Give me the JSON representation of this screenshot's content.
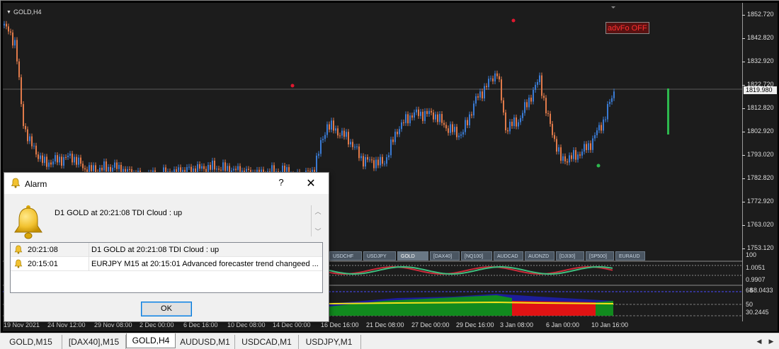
{
  "chart": {
    "symbol_label": "GOLD,H4",
    "advfo_label": "advFo OFF",
    "current_price": "1819.980",
    "price_ticks": [
      "1852.720",
      "1842.820",
      "1832.920",
      "1822.720",
      "1812.820",
      "1802.920",
      "1793.020",
      "1782.820",
      "1772.920",
      "1763.020",
      "1753.120"
    ],
    "colors": {
      "bull": "#3a7bd5",
      "bear": "#e07a4a",
      "signal_green": "#2db84d",
      "signal_red": "#e0182f",
      "background": "#1c1c1c"
    }
  },
  "symbol_bar": [
    "USDCHF",
    "USDJPY",
    "GOLD",
    "[DAX40]",
    "[NQ100]",
    "AUDCAD",
    "AUDNZD",
    "[DJI30]",
    "[SP500]",
    "EURAUD"
  ],
  "symbol_bar_active": "GOLD",
  "indicator1": {
    "ticks": [
      "100",
      "1.0051",
      "0.9907"
    ]
  },
  "indicator2": {
    "ticks": [
      "68",
      "68.0433",
      "50",
      "30.2445"
    ]
  },
  "date_axis": [
    "19 Nov 2021",
    "24 Nov 12:00",
    "29 Nov 08:00",
    "2 Dec 00:00",
    "6 Dec 16:00",
    "10 Dec 08:00",
    "14 Dec 00:00",
    "16 Dec 16:00",
    "21 Dec 08:00",
    "27 Dec 00:00",
    "29 Dec 16:00",
    "3 Jan 08:00",
    "6 Jan 00:00",
    "10 Jan 16:00"
  ],
  "tabs": [
    "GOLD,M15",
    "[DAX40],M15",
    "GOLD,H4",
    "AUDUSD,M1",
    "USDCAD,M1",
    "USDJPY,M1"
  ],
  "active_tab": "GOLD,H4",
  "dialog": {
    "title": "Alarm",
    "help": "?",
    "close": "✕",
    "message": "D1 GOLD at 20:21:08 TDI Cloud :  up",
    "rows": [
      {
        "time": "20:21:08",
        "text": "D1 GOLD at 20:21:08 TDI Cloud :  up"
      },
      {
        "time": "20:15:01",
        "text": "EURJPY M15 at 20:15:01 Advanced forecaster trend changeed ..."
      }
    ],
    "ok_label": "OK"
  }
}
